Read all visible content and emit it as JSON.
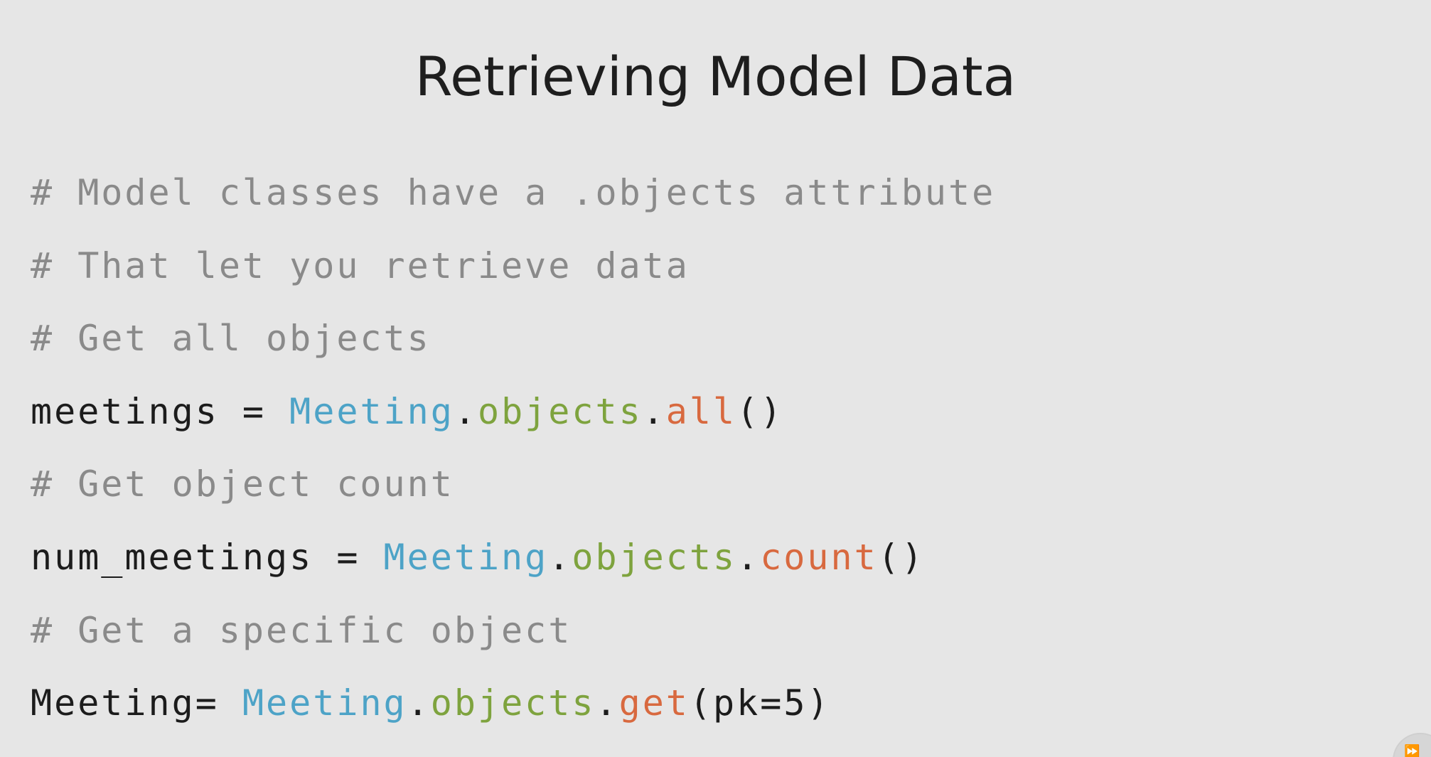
{
  "slide": {
    "title": "Retrieving Model Data",
    "code_lines": [
      {
        "tokens": [
          {
            "type": "comment",
            "text": "# Model classes have a .objects attribute"
          }
        ]
      },
      {
        "tokens": [
          {
            "type": "comment",
            "text": "# That let you retrieve data"
          }
        ]
      },
      {
        "tokens": [
          {
            "type": "comment",
            "text": "# Get all objects"
          }
        ]
      },
      {
        "tokens": [
          {
            "type": "plain",
            "text": "meetings = "
          },
          {
            "type": "cls",
            "text": "Meeting"
          },
          {
            "type": "plain",
            "text": "."
          },
          {
            "type": "attr",
            "text": "objects"
          },
          {
            "type": "plain",
            "text": "."
          },
          {
            "type": "method",
            "text": "all"
          },
          {
            "type": "plain",
            "text": "()"
          }
        ]
      },
      {
        "tokens": [
          {
            "type": "comment",
            "text": "# Get object count"
          }
        ]
      },
      {
        "tokens": [
          {
            "type": "plain",
            "text": "num_meetings = "
          },
          {
            "type": "cls",
            "text": "Meeting"
          },
          {
            "type": "plain",
            "text": "."
          },
          {
            "type": "attr",
            "text": "objects"
          },
          {
            "type": "plain",
            "text": "."
          },
          {
            "type": "method",
            "text": "count"
          },
          {
            "type": "plain",
            "text": "()"
          }
        ]
      },
      {
        "tokens": [
          {
            "type": "comment",
            "text": "# Get a specific object"
          }
        ]
      },
      {
        "tokens": [
          {
            "type": "plain",
            "text": "Meeting= "
          },
          {
            "type": "cls",
            "text": "Meeting"
          },
          {
            "type": "plain",
            "text": "."
          },
          {
            "type": "attr",
            "text": "objects"
          },
          {
            "type": "plain",
            "text": "."
          },
          {
            "type": "method",
            "text": "get"
          },
          {
            "type": "plain",
            "text": "(pk=5)"
          }
        ]
      }
    ]
  },
  "colors": {
    "background": "#e6e6e6",
    "title": "#1e1e1e",
    "comment": "#8a8a8a",
    "plain": "#1c1c1c",
    "class": "#4da3c7",
    "attribute": "#7ea33e",
    "method": "#d8693f"
  },
  "icons": {
    "corner": "video-player-watermark-icon"
  }
}
